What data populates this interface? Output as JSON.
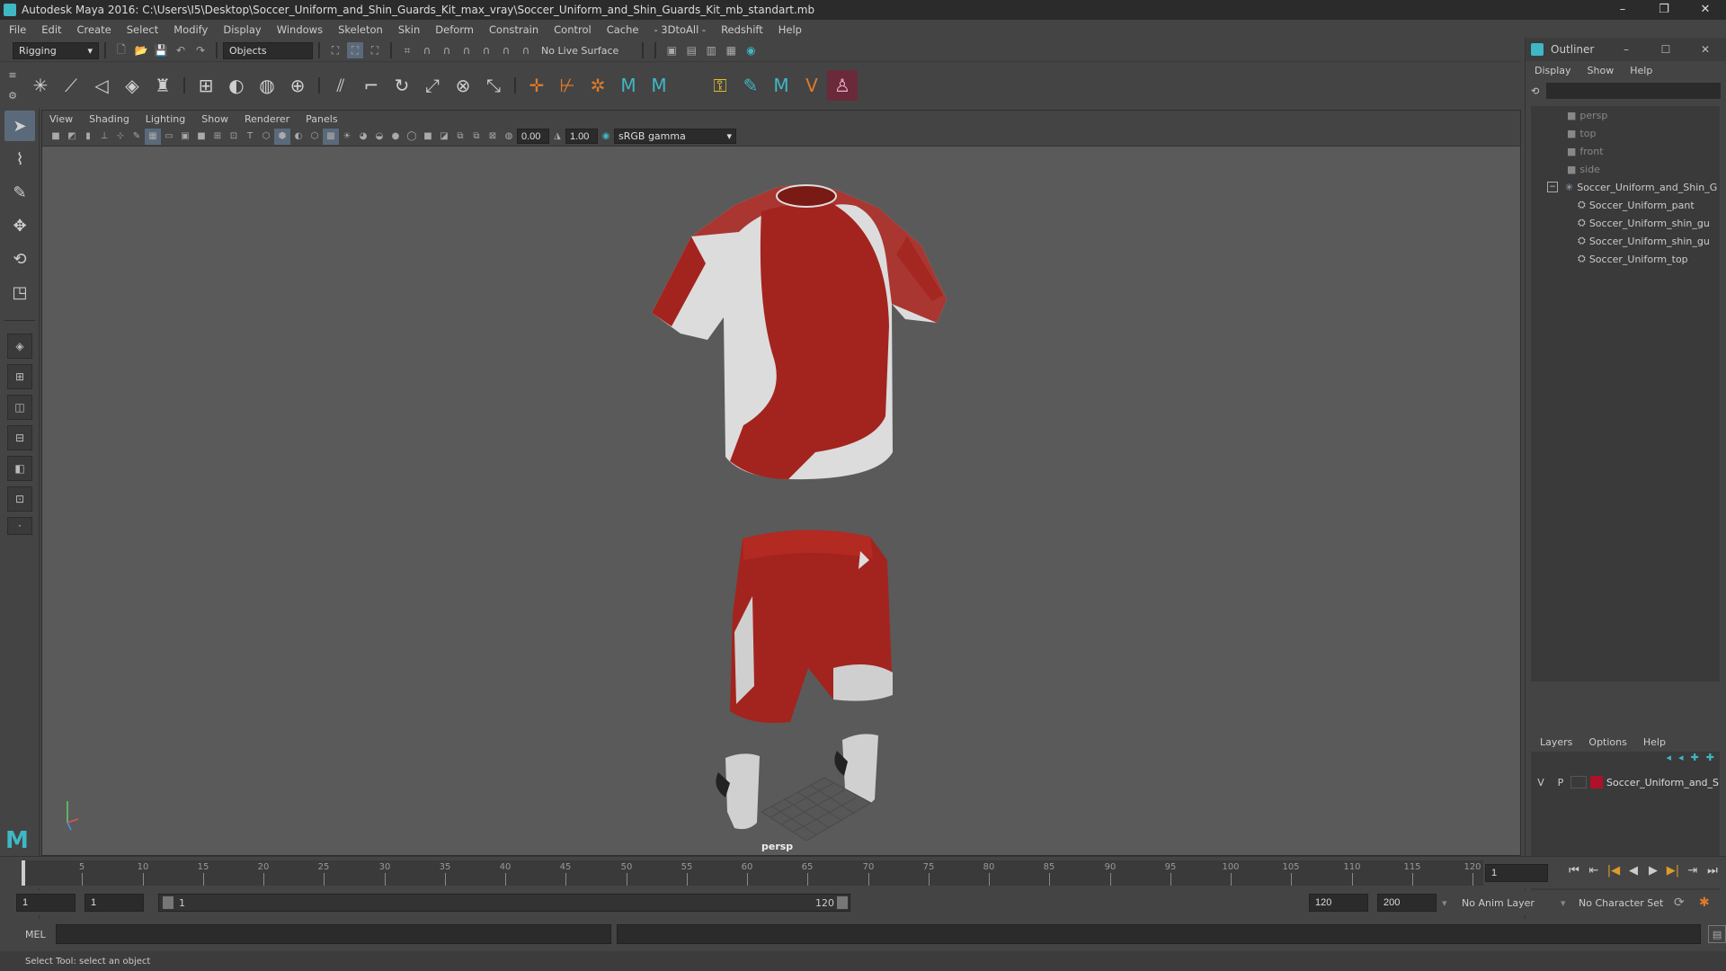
{
  "window": {
    "title": "Autodesk Maya 2016: C:\\Users\\I5\\Desktop\\Soccer_Uniform_and_Shin_Guards_Kit_max_vray\\Soccer_Uniform_and_Shin_Guards_Kit_mb_standart.mb",
    "minimize": "–",
    "restore": "❐",
    "close": "✕"
  },
  "menubar": [
    "File",
    "Edit",
    "Create",
    "Select",
    "Modify",
    "Display",
    "Windows",
    "Skeleton",
    "Skin",
    "Deform",
    "Constrain",
    "Control",
    "Cache",
    "- 3DtoAll -",
    "Redshift",
    "Help"
  ],
  "statusline": {
    "menuset": "Rigging",
    "select_mode": "Objects",
    "live_surface": "No Live Surface"
  },
  "viewport": {
    "menu": [
      "View",
      "Shading",
      "Lighting",
      "Show",
      "Renderer",
      "Panels"
    ],
    "exposure": "0.00",
    "gamma": "1.00",
    "color_space": "sRGB gamma",
    "camera_label": "persp"
  },
  "outliner": {
    "title": "Outliner",
    "menu": [
      "Display",
      "Show",
      "Help"
    ],
    "items": [
      {
        "label": "persp",
        "type": "camera"
      },
      {
        "label": "top",
        "type": "camera"
      },
      {
        "label": "front",
        "type": "camera"
      },
      {
        "label": "side",
        "type": "camera"
      },
      {
        "label": "Soccer_Uniform_and_Shin_G",
        "type": "group"
      },
      {
        "label": "Soccer_Uniform_pant",
        "type": "mesh"
      },
      {
        "label": "Soccer_Uniform_shin_gu",
        "type": "mesh"
      },
      {
        "label": "Soccer_Uniform_shin_gu",
        "type": "mesh"
      },
      {
        "label": "Soccer_Uniform_top",
        "type": "mesh"
      }
    ],
    "expand_toggle": "−"
  },
  "layers": {
    "menu": [
      "Layers",
      "Options",
      "Help"
    ],
    "row": {
      "v": "V",
      "p": "P",
      "name": "Soccer_Uniform_and_S",
      "color": "#b0102a"
    }
  },
  "timeline": {
    "ticks": [
      "5",
      "10",
      "15",
      "20",
      "25",
      "30",
      "35",
      "40",
      "45",
      "50",
      "55",
      "60",
      "65",
      "70",
      "75",
      "80",
      "85",
      "90",
      "95",
      "100",
      "105",
      "110",
      "115",
      "120"
    ],
    "current_frame": "1",
    "frame_field": "1"
  },
  "range": {
    "start": "1",
    "playback_start": "1",
    "slider_start": "1",
    "slider_end": "120",
    "playback_end": "120",
    "end": "200",
    "anim_layer": "No Anim Layer",
    "character_set": "No Character Set"
  },
  "cmdline": {
    "label": "MEL"
  },
  "help": "Select Tool: select an object",
  "colors": {
    "jersey_red": "#a3241e",
    "jersey_white": "#dcdcdc"
  }
}
